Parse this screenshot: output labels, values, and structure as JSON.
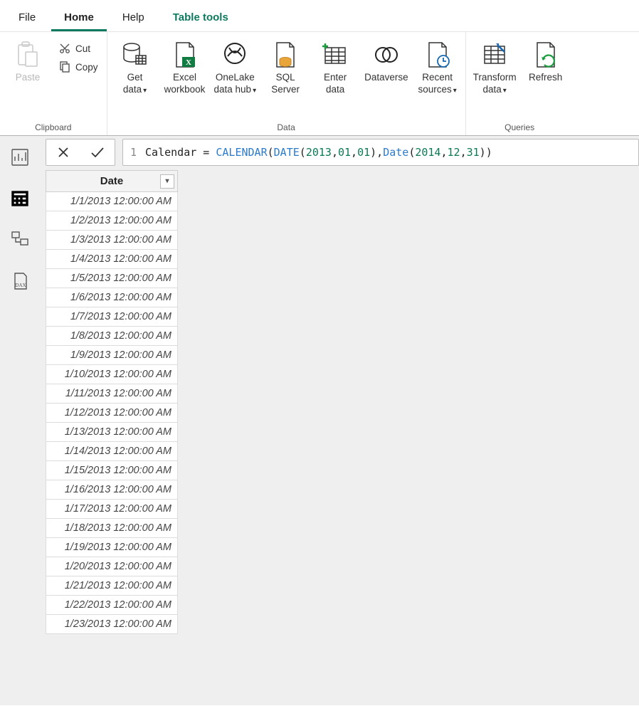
{
  "tabs": {
    "file": "File",
    "home": "Home",
    "help": "Help",
    "table_tools": "Table tools"
  },
  "ribbon": {
    "clipboard": {
      "label": "Clipboard",
      "paste": "Paste",
      "cut": "Cut",
      "copy": "Copy"
    },
    "data": {
      "label": "Data",
      "get_data": "Get\ndata",
      "excel": "Excel\nworkbook",
      "onelake": "OneLake\ndata hub",
      "sql": "SQL\nServer",
      "enter": "Enter\ndata",
      "dataverse": "Dataverse",
      "recent": "Recent\nsources"
    },
    "queries": {
      "label": "Queries",
      "transform": "Transform\ndata",
      "refresh": "Refresh"
    }
  },
  "formula": {
    "line": "1",
    "tokens": {
      "t1": "Calendar = ",
      "t2": "CALENDAR",
      "t3": "(",
      "t4": "DATE",
      "t5": "(",
      "t6": "2013",
      "t7": ",",
      "t8": "01",
      "t9": ",",
      "t10": "01",
      "t11": ")",
      "t12": ",",
      "t13": "Date",
      "t14": "(",
      "t15": "2014",
      "t16": ",",
      "t17": "12",
      "t18": ",",
      "t19": "31",
      "t20": ")",
      "t21": ")"
    }
  },
  "table": {
    "header": "Date",
    "rows": [
      "1/1/2013 12:00:00 AM",
      "1/2/2013 12:00:00 AM",
      "1/3/2013 12:00:00 AM",
      "1/4/2013 12:00:00 AM",
      "1/5/2013 12:00:00 AM",
      "1/6/2013 12:00:00 AM",
      "1/7/2013 12:00:00 AM",
      "1/8/2013 12:00:00 AM",
      "1/9/2013 12:00:00 AM",
      "1/10/2013 12:00:00 AM",
      "1/11/2013 12:00:00 AM",
      "1/12/2013 12:00:00 AM",
      "1/13/2013 12:00:00 AM",
      "1/14/2013 12:00:00 AM",
      "1/15/2013 12:00:00 AM",
      "1/16/2013 12:00:00 AM",
      "1/17/2013 12:00:00 AM",
      "1/18/2013 12:00:00 AM",
      "1/19/2013 12:00:00 AM",
      "1/20/2013 12:00:00 AM",
      "1/21/2013 12:00:00 AM",
      "1/22/2013 12:00:00 AM",
      "1/23/2013 12:00:00 AM"
    ]
  }
}
